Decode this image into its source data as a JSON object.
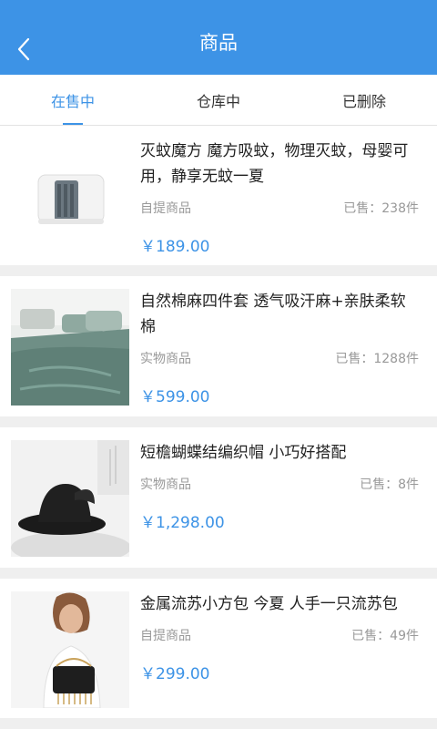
{
  "header": {
    "title": "商品"
  },
  "tabs": [
    {
      "label": "在售中",
      "active": true
    },
    {
      "label": "仓库中",
      "active": false
    },
    {
      "label": "已删除",
      "active": false
    }
  ],
  "products": [
    {
      "title": "灭蚊魔方 魔方吸蚊，物理灭蚊，母婴可用，静享无蚊一夏",
      "type": "自提商品",
      "sold": "已售：238件",
      "price": "￥189.00"
    },
    {
      "title": "自然棉麻四件套 透气吸汗麻+亲肤柔软棉",
      "type": "实物商品",
      "sold": "已售：1288件",
      "price": "￥599.00"
    },
    {
      "title": "短檐蝴蝶结编织帽 小巧好搭配",
      "type": "实物商品",
      "sold": "已售：8件",
      "price": "￥1,298.00"
    },
    {
      "title": "金属流苏小方包 今夏 人手一只流苏包",
      "type": "自提商品",
      "sold": "已售：49件",
      "price": "￥299.00"
    }
  ],
  "colors": {
    "accent": "#3d93e6",
    "background": "#efefef"
  }
}
